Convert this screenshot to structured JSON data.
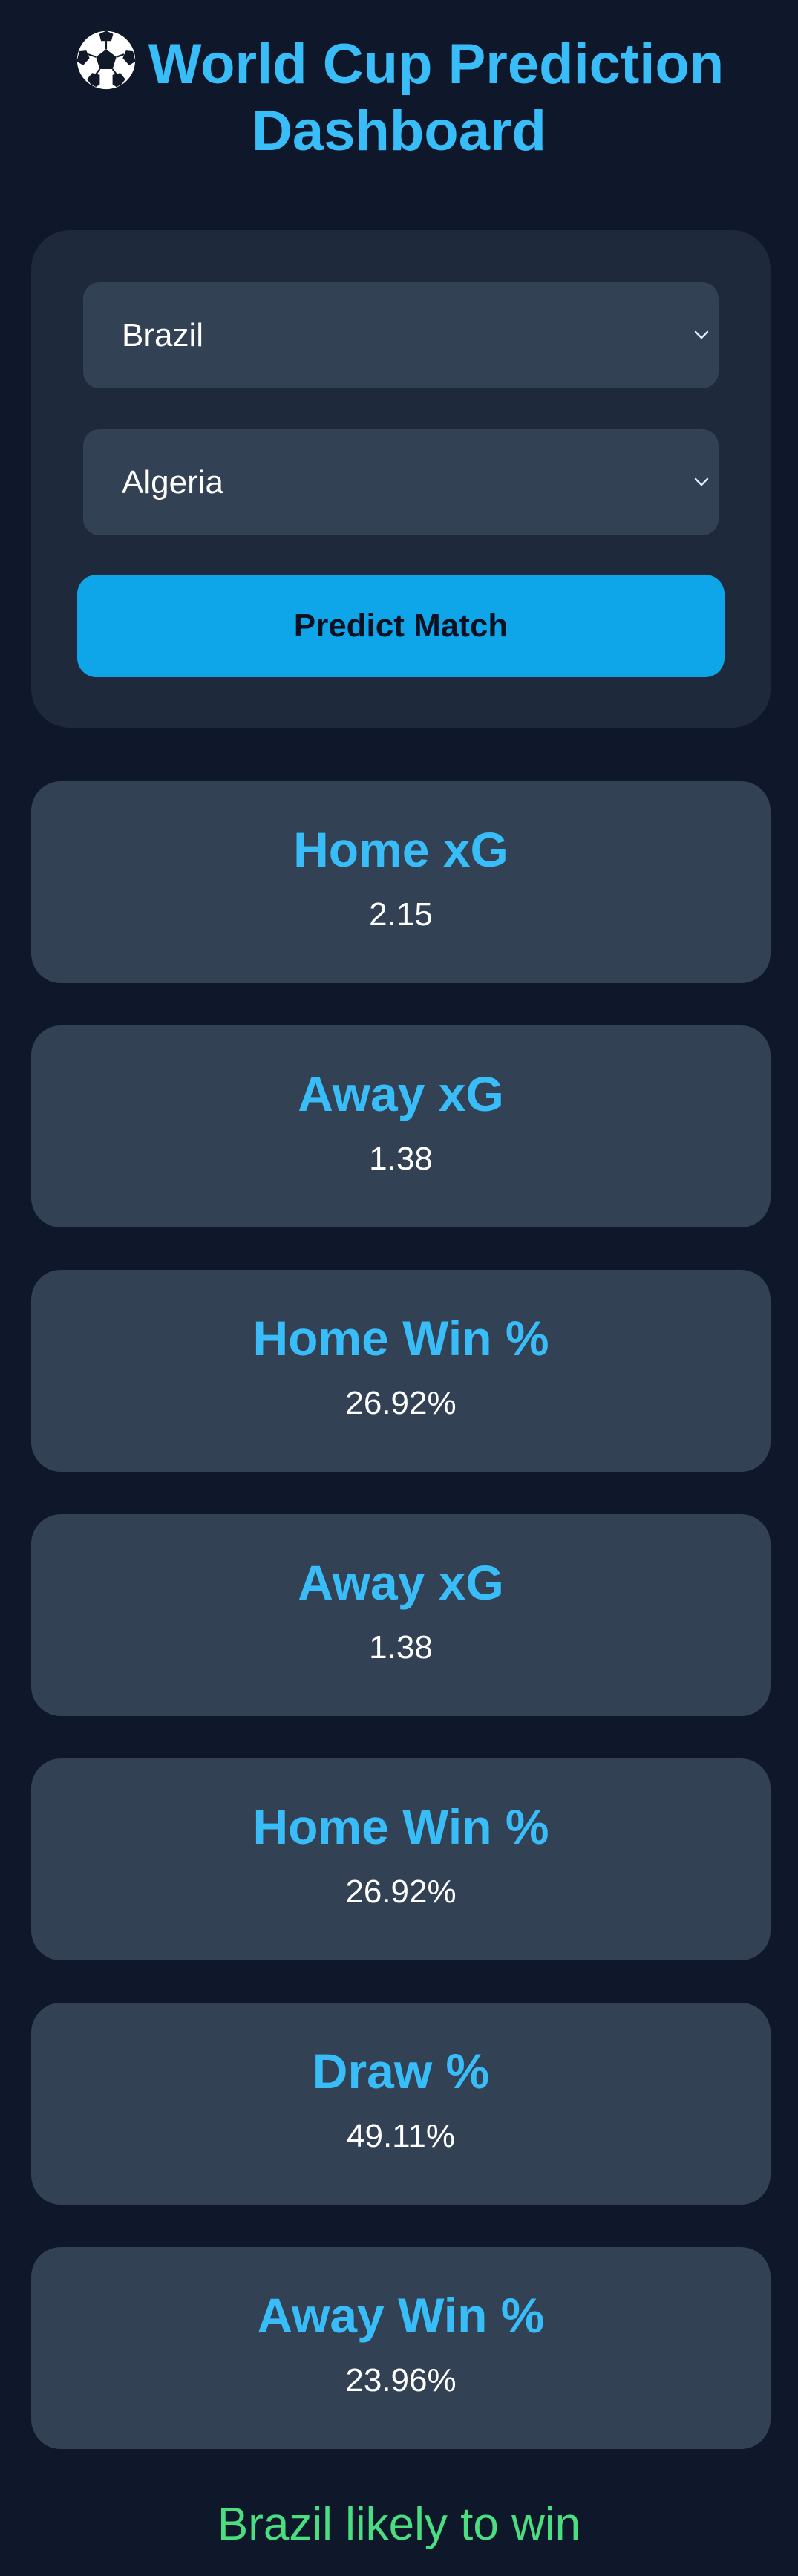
{
  "header": {
    "icon": "soccer-ball-icon",
    "title": "World Cup Prediction Dashboard"
  },
  "controls": {
    "home_team": {
      "selected": "Brazil",
      "icon": "chevron-down-icon"
    },
    "away_team": {
      "selected": "Algeria",
      "icon": "chevron-down-icon"
    },
    "predict_button": {
      "label": "Predict Match",
      "color": "#0ea5e9"
    }
  },
  "stats": [
    {
      "label": "Home xG",
      "value": "2.15"
    },
    {
      "label": "Away xG",
      "value": "1.38"
    },
    {
      "label": "Home Win %",
      "value": "26.92%"
    },
    {
      "label": "Away xG",
      "value": "1.38"
    },
    {
      "label": "Home Win %",
      "value": "26.92%"
    },
    {
      "label": "Draw %",
      "value": "49.11%"
    },
    {
      "label": "Away Win %",
      "value": "23.96%"
    }
  ],
  "result": {
    "text": "Brazil likely to win",
    "color": "#4ade80"
  },
  "colors": {
    "background": "#0f172a",
    "panel": "#1e293b",
    "card": "#334155",
    "accent": "#38bdf8"
  }
}
